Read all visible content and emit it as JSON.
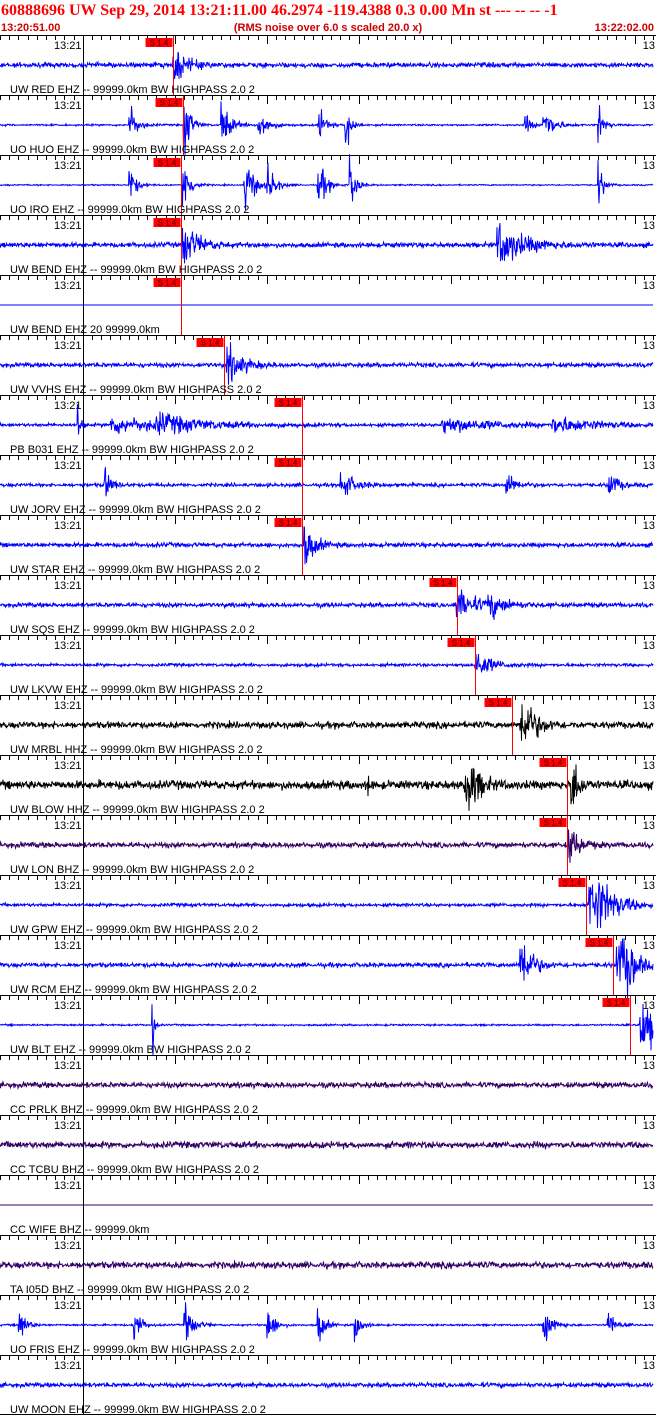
{
  "header": {
    "title": "60888696 UW Sep 29, 2014 13:21:11.00   46.2974 -119.4388  0.3 0.00 Mn st --- -- --   -1",
    "start_time": "13:20:51.00",
    "noise_note": "(RMS noise over 6.0 s scaled 20.0 x)",
    "end_time": "13:22:02.00"
  },
  "colors": {
    "pick": "#ff0000",
    "grid": "#000000",
    "blue": "#0000ff",
    "black": "#000000",
    "purple": "#330066"
  },
  "chart_data": {
    "type": "line",
    "title": "60888696 UW Sep 29, 2014 13:21:11.00",
    "x_range_seconds": [
      0,
      71
    ],
    "minute_label": "13:21",
    "minute_label_right": "13",
    "pick_label": "S 1.4",
    "traces": [
      {
        "label": "UW RED EHZ -- 99999.0km BW  HIGHPASS  2.0  2",
        "color": "blue",
        "pick": 18.8,
        "noise": 2.2,
        "bursts": [
          [
            18.8,
            5,
            1.2
          ]
        ]
      },
      {
        "label": "UO HUO EHZ -- 99999.0km BW  HIGHPASS  2.0  2",
        "color": "blue",
        "pick": 19.9,
        "noise": 0.8,
        "bursts": [
          [
            14,
            6,
            0.7
          ],
          [
            19.9,
            11,
            0.6
          ],
          [
            24,
            7,
            0.8
          ],
          [
            28,
            6,
            0.8
          ],
          [
            34.5,
            6,
            0.6
          ],
          [
            37.5,
            9,
            0.5
          ],
          [
            57,
            4,
            0.5
          ],
          [
            59,
            5,
            1.0
          ],
          [
            65,
            6,
            0.5
          ]
        ]
      },
      {
        "label": "UO IRO EHZ -- 99999.0km BW  HIGHPASS  2.0  2",
        "color": "blue",
        "pick": 19.7,
        "noise": 0.6,
        "bursts": [
          [
            14,
            6,
            0.6
          ],
          [
            19.8,
            11,
            0.6
          ],
          [
            26.5,
            10,
            0.8
          ],
          [
            29,
            6,
            0.7
          ],
          [
            34.5,
            8,
            0.7
          ],
          [
            38,
            10,
            0.5
          ],
          [
            65,
            6,
            0.5
          ]
        ]
      },
      {
        "label": "UW BEND EHZ -- 99999.0km BW  HIGHPASS  2.0  2",
        "color": "blue",
        "pick": 19.7,
        "noise": 2.2,
        "bursts": [
          [
            19.8,
            6,
            1.5
          ],
          [
            54,
            6,
            2.5
          ]
        ]
      },
      {
        "label": "UW BEND EHZ 20 99999.0km",
        "color": "blue",
        "pick": 19.7,
        "noise": 0,
        "bursts": []
      },
      {
        "label": "UW VVHS EHZ -- 99999.0km BW  HIGHPASS  2.0  2",
        "color": "blue",
        "pick": 24.4,
        "noise": 2.0,
        "bursts": [
          [
            24.6,
            5,
            1.5
          ]
        ]
      },
      {
        "label": "PB B031 EHZ -- 99999.0km BW  HIGHPASS  2.0  2",
        "color": "blue",
        "pick": 32.8,
        "noise": 1.5,
        "bursts": [
          [
            8.4,
            6,
            0.3
          ],
          [
            12,
            2,
            6.0
          ],
          [
            17,
            2,
            4.0
          ],
          [
            48,
            2,
            5.0
          ],
          [
            60,
            2,
            4.0
          ]
        ]
      },
      {
        "label": "UW JORV EHZ -- 99999.0km BW  HIGHPASS  2.0  2",
        "color": "blue",
        "pick": 32.8,
        "noise": 1.6,
        "bursts": [
          [
            11.3,
            5,
            0.6
          ],
          [
            37,
            4,
            1.2
          ],
          [
            55,
            4,
            0.8
          ],
          [
            66,
            5,
            0.8
          ]
        ]
      },
      {
        "label": "UW STAR EHZ -- 99999.0km BW  HIGHPASS  2.0  2",
        "color": "blue",
        "pick": 32.8,
        "noise": 2.0,
        "bursts": [
          [
            33,
            6,
            1.0
          ]
        ]
      },
      {
        "label": "UW SQS EHZ -- 99999.0km BW  HIGHPASS  2.0  2",
        "color": "blue",
        "pick": 49.7,
        "noise": 2.0,
        "bursts": [
          [
            49.5,
            4,
            2.0
          ],
          [
            53,
            3,
            1.5
          ]
        ]
      },
      {
        "label": "UW LKVW EHZ -- 99999.0km BW  HIGHPASS  2.0  2",
        "color": "blue",
        "pick": 51.6,
        "noise": 1.4,
        "bursts": [
          [
            51.6,
            4,
            1.5
          ]
        ]
      },
      {
        "label": "UW MRBL HHZ -- 99999.0km BW  HIGHPASS  2.0  2",
        "color": "black",
        "pick": 55.7,
        "noise": 3.0,
        "bursts": [
          [
            56.5,
            10,
            1.2
          ]
        ]
      },
      {
        "label": "UW BLOW HHZ -- 99999.0km BW  HIGHPASS  2.0  2",
        "color": "black",
        "pick": 61.7,
        "noise": 4.0,
        "bursts": [
          [
            40,
            9,
            0.1
          ],
          [
            50.5,
            12,
            1.0
          ],
          [
            62,
            12,
            0.6
          ]
        ]
      },
      {
        "label": "UW LON BHZ -- 99999.0km BW  HIGHPASS  2.0  2",
        "color": "purple",
        "pick": 61.7,
        "noise": 2.5,
        "bursts": [
          [
            61.7,
            6,
            1.0
          ]
        ]
      },
      {
        "label": "UW GPW EHZ -- 99999.0km BW  HIGHPASS  2.0  2",
        "color": "blue",
        "pick": 63.7,
        "noise": 1.5,
        "bursts": [
          [
            63.9,
            12,
            2.0
          ]
        ]
      },
      {
        "label": "UW RCM EHZ -- 99999.0km BW  HIGHPASS  2.0  2",
        "color": "blue",
        "pick": 66.7,
        "noise": 2.0,
        "bursts": [
          [
            56.5,
            10,
            1.0
          ],
          [
            67,
            27,
            1.0
          ]
        ]
      },
      {
        "label": "UW BLT EHZ -- 99999.0km BW  HIGHPASS  2.0  2",
        "color": "blue",
        "pick": 68.5,
        "noise": 0.8,
        "bursts": [
          [
            16.5,
            26,
            0.15
          ],
          [
            69.5,
            10,
            1.5
          ]
        ]
      },
      {
        "label": "CC PRLK BHZ -- 99999.0km BW  HIGHPASS  2.0  2",
        "color": "purple",
        "pick": null,
        "noise": 2.5,
        "bursts": []
      },
      {
        "label": "CC TCBU BHZ -- 99999.0km BW  HIGHPASS  2.0  2",
        "color": "purple",
        "pick": null,
        "noise": 3.0,
        "bursts": []
      },
      {
        "label": "CC WIFE BHZ -- 99999.0km",
        "color": "purple",
        "pick": null,
        "noise": 0,
        "bursts": []
      },
      {
        "label": "TA I05D BHZ -- 99999.0km BW  HIGHPASS  2.0  2",
        "color": "purple",
        "pick": null,
        "noise": 3.0,
        "bursts": []
      },
      {
        "label": "UO FRIS EHZ -- 99999.0km BW  HIGHPASS  2.0  2",
        "color": "blue",
        "pick": null,
        "noise": 0.8,
        "bursts": [
          [
            2,
            6,
            0.6
          ],
          [
            14.5,
            6,
            0.6
          ],
          [
            20,
            6,
            0.8
          ],
          [
            29,
            8,
            0.6
          ],
          [
            34.5,
            6,
            0.6
          ],
          [
            38.5,
            5,
            0.6
          ],
          [
            59,
            5,
            0.9
          ],
          [
            66,
            5,
            0.6
          ]
        ]
      },
      {
        "label": "UW MOON EHZ -- 99999.0km BW  HIGHPASS  2.0  2",
        "color": "blue",
        "pick": null,
        "noise": 2.0,
        "bursts": []
      }
    ]
  }
}
